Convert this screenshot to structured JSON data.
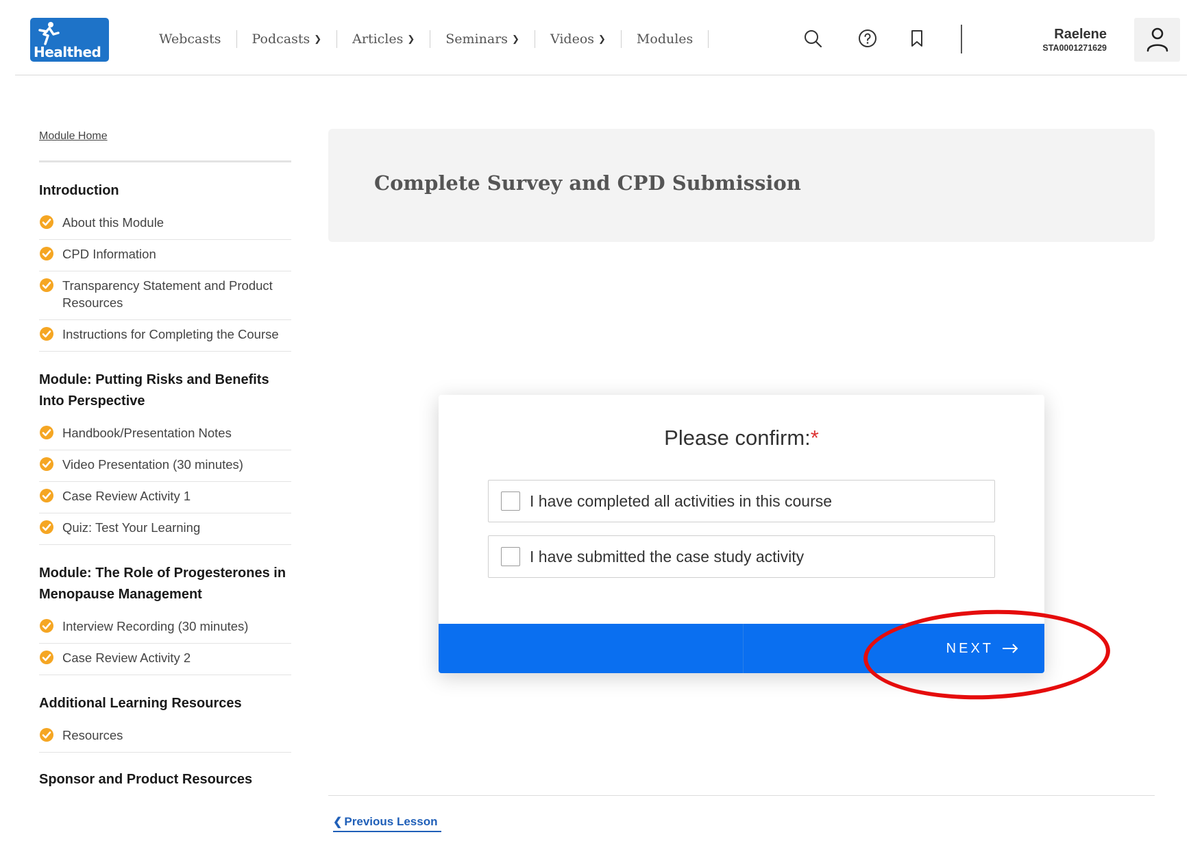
{
  "header": {
    "logo_text": "Healthed",
    "nav": [
      {
        "label": "Webcasts",
        "dropdown": false
      },
      {
        "label": "Podcasts",
        "dropdown": true
      },
      {
        "label": "Articles",
        "dropdown": true
      },
      {
        "label": "Seminars",
        "dropdown": true
      },
      {
        "label": "Videos",
        "dropdown": true
      },
      {
        "label": "Modules",
        "dropdown": false
      }
    ],
    "icons": [
      "search-icon",
      "help-icon",
      "bookmark-icon"
    ],
    "user": {
      "name": "Raelene",
      "id": "STA0001271629"
    }
  },
  "sidebar": {
    "module_home": "Module Home",
    "sections": [
      {
        "heading": "Introduction",
        "items": [
          "About this Module",
          "CPD Information",
          "Transparency Statement and Product Resources",
          "Instructions for Completing the Course"
        ]
      },
      {
        "heading": "Module: Putting Risks and Benefits Into Perspective",
        "items": [
          "Handbook/Presentation Notes",
          "Video Presentation (30 minutes)",
          "Case Review Activity 1",
          "Quiz: Test Your Learning"
        ]
      },
      {
        "heading": "Module: The Role of Progesterones in Menopause Management",
        "items": [
          "Interview Recording (30 minutes)",
          "Case Review Activity 2"
        ]
      },
      {
        "heading": "Additional Learning Resources",
        "items": [
          "Resources"
        ]
      }
    ],
    "last_heading": "Sponsor and Product Resources"
  },
  "main": {
    "title": "Complete Survey and CPD Submission",
    "confirm": {
      "title": "Please confirm:",
      "required_mark": "*",
      "options": [
        {
          "label": "I have completed all activities in this course",
          "checked": false
        },
        {
          "label": "I have submitted the case study activity",
          "checked": false
        }
      ],
      "next_label": "NEXT"
    },
    "previous_lesson": "Previous Lesson"
  },
  "colors": {
    "brand_blue": "#1e73c8",
    "button_blue": "#0a6ff0",
    "check_orange": "#f5a623",
    "annotation_red": "#e50c0c",
    "link_blue": "#1f5fb8"
  }
}
